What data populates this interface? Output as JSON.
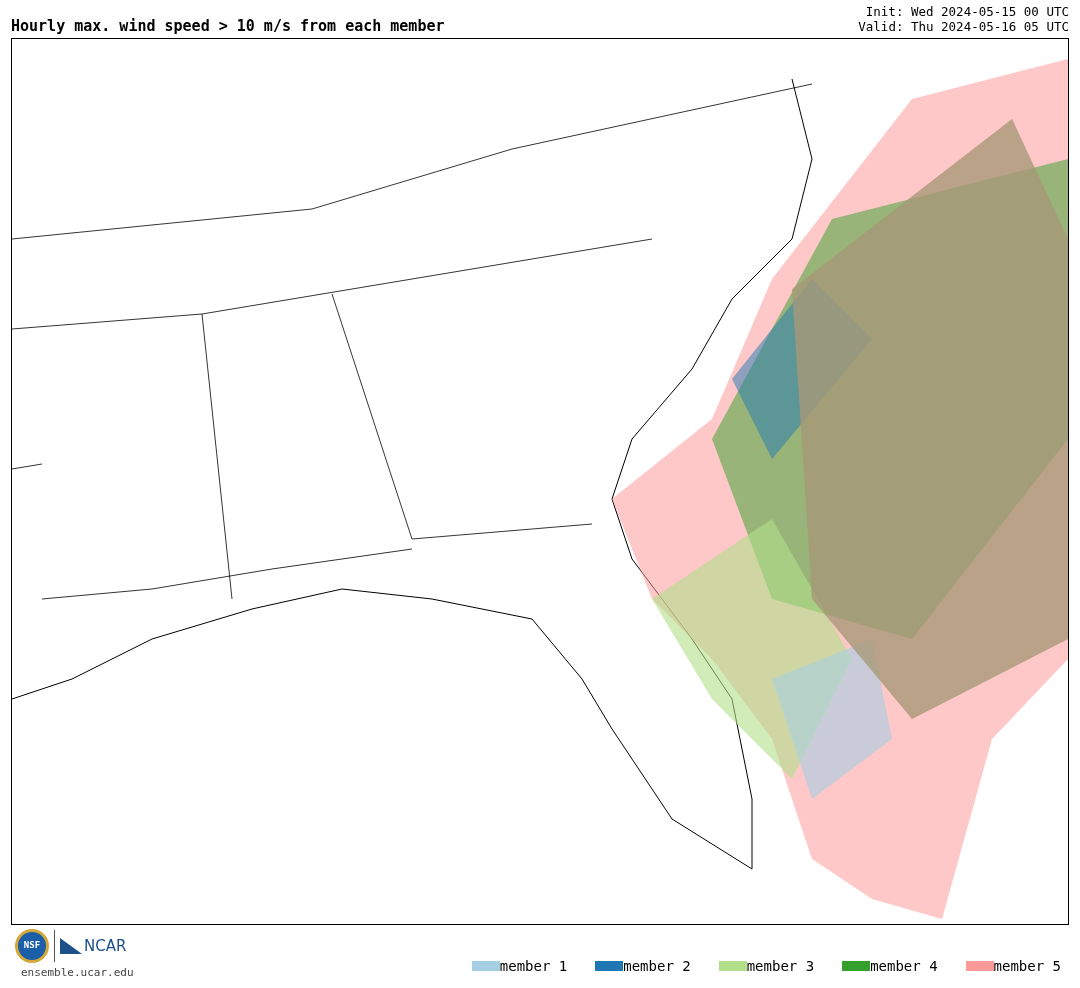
{
  "title": "Hourly max. wind speed > 10 m/s from each member",
  "init": "Init: Wed 2024-05-15 00 UTC",
  "valid": "Valid: Thu 2024-05-16 05 UTC",
  "logos": {
    "nsf": "NSF",
    "ncar": "NCAR",
    "url": "ensemble.ucar.edu"
  },
  "legend": [
    {
      "label": "member 1",
      "color": "#a6cee3"
    },
    {
      "label": "member 2",
      "color": "#1f78b4"
    },
    {
      "label": "member 3",
      "color": "#b2df8a"
    },
    {
      "label": "member 4",
      "color": "#33a02c"
    },
    {
      "label": "member 5",
      "color": "#fb9a99"
    }
  ]
}
